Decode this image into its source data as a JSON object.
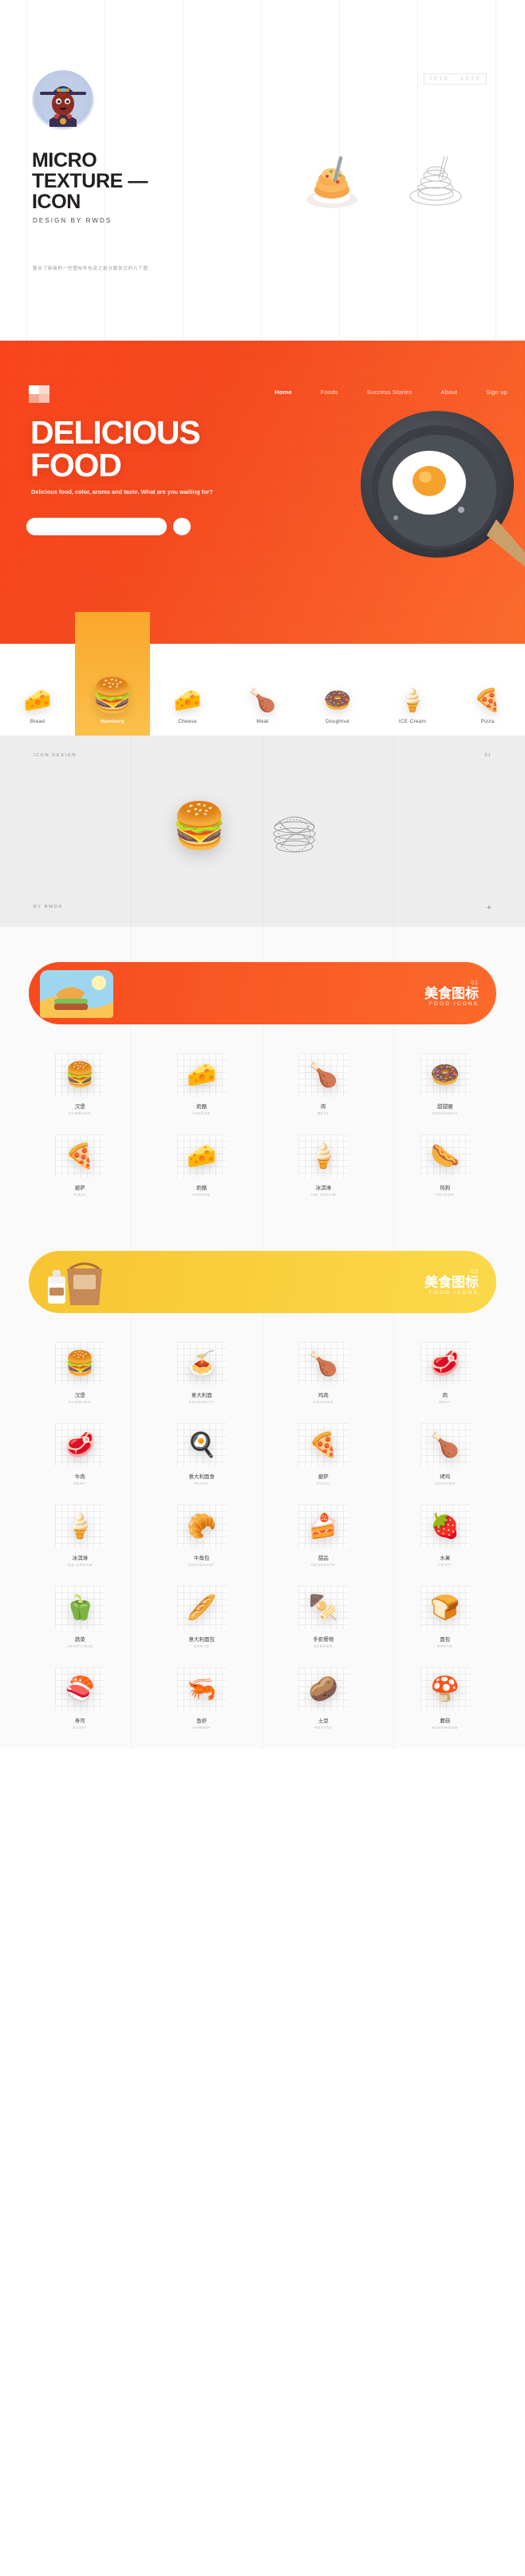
{
  "cover": {
    "avatar_icon": "avatar-cowboy-icon",
    "title_lines": [
      "MICRO",
      "TEXTURE —",
      "ICON"
    ],
    "title": "MICRO\nTEXTURE —\nICON",
    "subtitle": "DESIGN BY RWDS",
    "description": "整合了新接的一些图标外包及之前分散发过的几个图",
    "year": "2018 - 2020",
    "art_color_icon": "pasta-color-icon",
    "art_line_icon": "pasta-wireframe-icon"
  },
  "hero": {
    "brand_icon": "brand-squares-icon",
    "nav": [
      {
        "label": "Home",
        "active": true
      },
      {
        "label": "Foods",
        "active": false
      },
      {
        "label": "Success Stories",
        "active": false
      },
      {
        "label": "About",
        "active": false
      },
      {
        "label": "Sign up",
        "active": false
      }
    ],
    "headline_lines": [
      "DELICIOUS",
      "FOOD"
    ],
    "headline": "DELICIOUS\nFOOD",
    "paragraph": "Delicious food, color, aroma and taste. What are you waiting for?",
    "search_placeholder": "",
    "search_value": "",
    "search_button_icon": "search-circle-icon",
    "art_icon": "frying-pan-egg-icon",
    "bg_color": "#f7481e"
  },
  "categories": [
    {
      "name": "Bread",
      "icon": "bread-cheese-icon",
      "glyph": "🧀",
      "active": false
    },
    {
      "name": "Hamburg",
      "icon": "hamburger-icon",
      "glyph": "🍔",
      "active": true
    },
    {
      "name": "Cheese",
      "icon": "cheese-icon",
      "glyph": "🧀",
      "active": false
    },
    {
      "name": "Meat",
      "icon": "meat-icon",
      "glyph": "🍗",
      "active": false
    },
    {
      "name": "Doughnut",
      "icon": "doughnut-icon",
      "glyph": "🍩",
      "active": false
    },
    {
      "name": "ICE-Cream",
      "icon": "ice-cream-icon",
      "glyph": "🍦",
      "active": false
    },
    {
      "name": "Pizza",
      "icon": "pizza-icon",
      "glyph": "🍕",
      "active": false
    }
  ],
  "icon_design": {
    "label": "ICON DESIGN",
    "number": "01",
    "by": "BY RWDS",
    "plus": "+",
    "art_icon": "hamburger-3d-icon",
    "wire_icon": "hamburger-wireframe-icon",
    "glyph": "🍔"
  },
  "set1": {
    "banner": {
      "num": "01",
      "cn": "美食图标",
      "en": "FOOD ICONS",
      "art_icon": "hand-holding-burger-icon",
      "color": "#f74a1d"
    },
    "icons": [
      {
        "cn": "汉堡",
        "en": "HAMBURG",
        "icon": "hamburger-icon",
        "glyph": "🍔"
      },
      {
        "cn": "奶酪",
        "en": "CHEESE",
        "icon": "cheese-icon",
        "glyph": "🧀"
      },
      {
        "cn": "肉",
        "en": "MEAT",
        "icon": "meat-icon",
        "glyph": "🍗"
      },
      {
        "cn": "甜甜圈",
        "en": "DOUGHNUT",
        "icon": "doughnut-icon",
        "glyph": "🍩"
      },
      {
        "cn": "披萨",
        "en": "PIZZA",
        "icon": "pizza-icon",
        "glyph": "🍕"
      },
      {
        "cn": "奶酪",
        "en": "CHEESE",
        "icon": "cheese-wedge-icon",
        "glyph": "🧀"
      },
      {
        "cn": "冰淇淋",
        "en": "ICE CREAM",
        "icon": "ice-cream-icon",
        "glyph": "🍦"
      },
      {
        "cn": "热狗",
        "en": "HOTDOG",
        "icon": "hotdog-icon",
        "glyph": "🌭"
      }
    ]
  },
  "set2": {
    "banner": {
      "num": "02",
      "cn": "美食图标",
      "en": "FOOD ICONS",
      "art_icon": "takeaway-bag-coffee-icon",
      "color": "#f7c531"
    },
    "icons": [
      {
        "cn": "汉堡",
        "en": "HAMBURG",
        "icon": "hamburger-icon",
        "glyph": "🍔"
      },
      {
        "cn": "意大利面",
        "en": "SPAGHETTI",
        "icon": "spaghetti-icon",
        "glyph": "🍝"
      },
      {
        "cn": "鸡肉",
        "en": "CHICKEN",
        "icon": "roast-chicken-icon",
        "glyph": "🍗"
      },
      {
        "cn": "肉",
        "en": "MEAT",
        "icon": "steak-icon",
        "glyph": "🥩"
      },
      {
        "cn": "牛肉",
        "en": "BEEF",
        "icon": "beef-icon",
        "glyph": "🥩"
      },
      {
        "cn": "意大利面食",
        "en": "PASTA",
        "icon": "fried-egg-icon",
        "glyph": "🍳"
      },
      {
        "cn": "披萨",
        "en": "PIZZA",
        "icon": "pizza-icon",
        "glyph": "🍕"
      },
      {
        "cn": "烤鸡",
        "en": "CHICKEN",
        "icon": "whole-chicken-icon",
        "glyph": "🍗"
      },
      {
        "cn": "冰淇淋",
        "en": "ICE CREAM",
        "icon": "ice-cream-cone-icon",
        "glyph": "🍦"
      },
      {
        "cn": "牛角包",
        "en": "CROISSANT",
        "icon": "croissant-icon",
        "glyph": "🥐"
      },
      {
        "cn": "甜品",
        "en": "DESSERTS",
        "icon": "cake-slice-icon",
        "glyph": "🍰"
      },
      {
        "cn": "水果",
        "en": "FRUIT",
        "icon": "strawberry-icon",
        "glyph": "🍓"
      },
      {
        "cn": "蔬菜",
        "en": "VEGETABLE",
        "icon": "bell-pepper-icon",
        "glyph": "🫑"
      },
      {
        "cn": "意大利面包",
        "en": "BREAD",
        "icon": "baguette-icon",
        "glyph": "🥖"
      },
      {
        "cn": "手抓餐物",
        "en": "SKEWER",
        "icon": "skewer-icon",
        "glyph": "🍢"
      },
      {
        "cn": "面包",
        "en": "BREAD",
        "icon": "bread-loaf-icon",
        "glyph": "🍞"
      },
      {
        "cn": "寿司",
        "en": "SUSHI",
        "icon": "sushi-icon",
        "glyph": "🍣"
      },
      {
        "cn": "鱼虾",
        "en": "SHRIMP",
        "icon": "shrimp-icon",
        "glyph": "🦐"
      },
      {
        "cn": "土豆",
        "en": "POTATO",
        "icon": "potato-icon",
        "glyph": "🥔"
      },
      {
        "cn": "蘑菇",
        "en": "MUSHROOM",
        "icon": "mushroom-icon",
        "glyph": "🍄"
      }
    ]
  }
}
